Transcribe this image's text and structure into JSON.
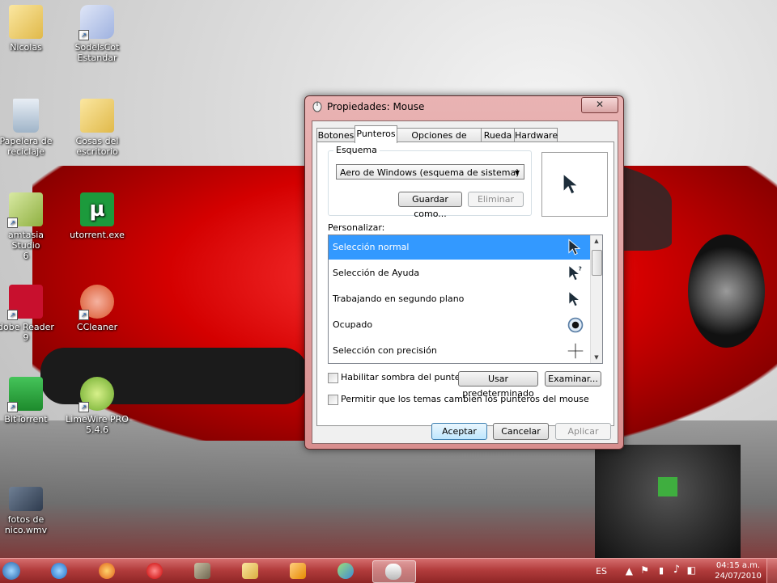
{
  "desktop": {
    "icons": [
      {
        "label": "Nicolas"
      },
      {
        "label": "SodelsCot\nEstandar"
      },
      {
        "label": "Papelera de\nreciclaje"
      },
      {
        "label": "Cosas del\nescritorio"
      },
      {
        "label": "amtasia Studio\n6"
      },
      {
        "label": "utorrent.exe"
      },
      {
        "label": "dobe Reader 9"
      },
      {
        "label": "CCleaner"
      },
      {
        "label": "BitTorrent"
      },
      {
        "label": "LimeWire PRO\n5.4.6"
      },
      {
        "label": "fotos de\nnico.wmv"
      }
    ]
  },
  "dialog": {
    "title": "Propiedades: Mouse",
    "close_symbol": "✕",
    "tabs": [
      "Botones",
      "Punteros",
      "Opciones de puntero",
      "Rueda",
      "Hardware"
    ],
    "active_tab": "Punteros",
    "scheme": {
      "label": "Esquema",
      "selected": "Aero de Windows (esquema de sistema)",
      "save_button": "Guardar como...",
      "delete_button": "Eliminar"
    },
    "customize_label": "Personalizar:",
    "pointers": [
      {
        "label": "Selección normal",
        "selected": true,
        "icon": "arrow-cursor-icon"
      },
      {
        "label": "Selección de Ayuda",
        "selected": false,
        "icon": "help-cursor-icon"
      },
      {
        "label": "Trabajando en segundo plano",
        "selected": false,
        "icon": "arrow-cursor-icon"
      },
      {
        "label": "Ocupado",
        "selected": false,
        "icon": "busy-cursor-icon"
      },
      {
        "label": "Selección con precisión",
        "selected": false,
        "icon": "crosshair-cursor-icon"
      }
    ],
    "shadow_checkbox": "Habilitar sombra del puntero",
    "themes_checkbox": "Permitir que los temas cambien los punteros del mouse",
    "use_default_button": "Usar predeterminado",
    "browse_button": "Examinar...",
    "ok_button": "Aceptar",
    "cancel_button": "Cancelar",
    "apply_button": "Aplicar"
  },
  "taskbar": {
    "language": "ES",
    "time": "04:15 a.m.",
    "date": "24/07/2010"
  },
  "colors": {
    "selection": "#3399ff",
    "taskbar": "#b33d3d",
    "dialog_frame": "#d88e8e"
  }
}
